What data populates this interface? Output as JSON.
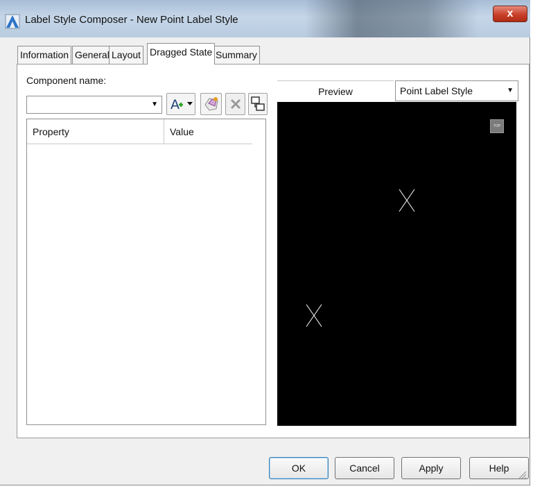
{
  "window": {
    "title": "Label Style Composer - New Point Label Style",
    "close_label": "x",
    "app_icon": "autocad-civil-a-icon"
  },
  "tabs": [
    {
      "label": "Information",
      "active": false
    },
    {
      "label": "General",
      "active": false
    },
    {
      "label": "Layout",
      "active": true
    },
    {
      "label": "Dragged State",
      "active": false
    },
    {
      "label": "Summary",
      "active": false
    }
  ],
  "layout": {
    "component_name_label": "Component name:",
    "component_name_value": "",
    "toolbar": {
      "create_text_component": "A",
      "icons": [
        "create-text-component-icon",
        "copy-component-icon",
        "delete-component-icon",
        "component-draw-order-icon"
      ]
    },
    "grid": {
      "columns": [
        "Property",
        "Value"
      ],
      "rows": []
    }
  },
  "preview": {
    "label": "Preview",
    "style_selected": "Point Label Style",
    "viewcube_label": "TOP",
    "background": "#000000",
    "marker_color": "#ffffff"
  },
  "buttons": {
    "ok": "OK",
    "cancel": "Cancel",
    "apply": "Apply",
    "help": "Help"
  }
}
